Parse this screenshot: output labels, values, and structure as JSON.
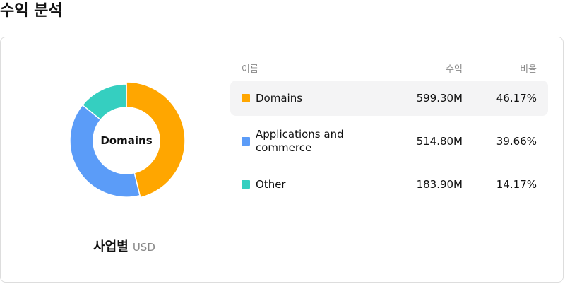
{
  "page": {
    "title": "수익 분석"
  },
  "chart": {
    "center_label": "Domains",
    "caption_title": "사업별",
    "caption_unit": "USD"
  },
  "table": {
    "headers": {
      "name": "이름",
      "value": "수익",
      "pct": "비율"
    },
    "rows": [
      {
        "name": "Domains",
        "value": "599.30M",
        "pct": "46.17%",
        "color": "#FFA600",
        "active": true
      },
      {
        "name": "Applications and commerce",
        "value": "514.80M",
        "pct": "39.66%",
        "color": "#5B9CF8",
        "active": false
      },
      {
        "name": "Other",
        "value": "183.90M",
        "pct": "14.17%",
        "color": "#35CFC0",
        "active": false
      }
    ]
  },
  "chart_data": {
    "type": "pie",
    "categories": [
      "Domains",
      "Applications and commerce",
      "Other"
    ],
    "values": [
      599.3,
      514.8,
      183.9
    ],
    "percentages": [
      46.17,
      39.66,
      14.17
    ],
    "colors": [
      "#FFA600",
      "#5B9CF8",
      "#35CFC0"
    ],
    "title": "사업별",
    "unit": "USD",
    "donut": true,
    "center_label": "Domains",
    "highlighted": "Domains"
  }
}
